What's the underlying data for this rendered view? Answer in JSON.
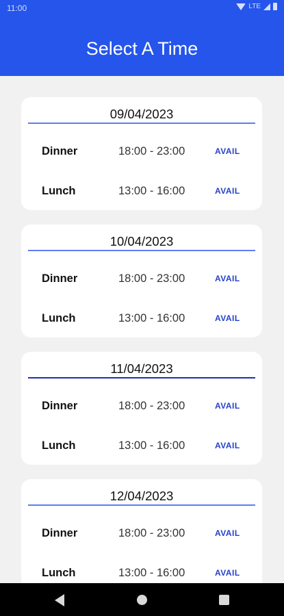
{
  "status": {
    "time": "11:00",
    "network": "LTE"
  },
  "header": {
    "title": "Select A Time"
  },
  "dates": [
    {
      "date": "09/04/2023",
      "slots": [
        {
          "meal": "Dinner",
          "hours": "18:00 - 23:00",
          "status": "AVAIL"
        },
        {
          "meal": "Lunch",
          "hours": "13:00 - 16:00",
          "status": "AVAIL"
        }
      ]
    },
    {
      "date": "10/04/2023",
      "slots": [
        {
          "meal": "Dinner",
          "hours": "18:00 - 23:00",
          "status": "AVAIL"
        },
        {
          "meal": "Lunch",
          "hours": "13:00 - 16:00",
          "status": "AVAIL"
        }
      ]
    },
    {
      "date": "11/04/2023",
      "slots": [
        {
          "meal": "Dinner",
          "hours": "18:00 - 23:00",
          "status": "AVAIL"
        },
        {
          "meal": "Lunch",
          "hours": "13:00 - 16:00",
          "status": "AVAIL"
        }
      ]
    },
    {
      "date": "12/04/2023",
      "slots": [
        {
          "meal": "Dinner",
          "hours": "18:00 - 23:00",
          "status": "AVAIL"
        },
        {
          "meal": "Lunch",
          "hours": "13:00 - 16:00",
          "status": "AVAIL"
        }
      ]
    }
  ],
  "nav": {
    "back_icon": "triangle-back",
    "home_icon": "circle-home",
    "recents_icon": "square-recents"
  },
  "colors": {
    "primary": "#2555ea",
    "avail": "#2541c8",
    "background": "#f1f1f1"
  }
}
